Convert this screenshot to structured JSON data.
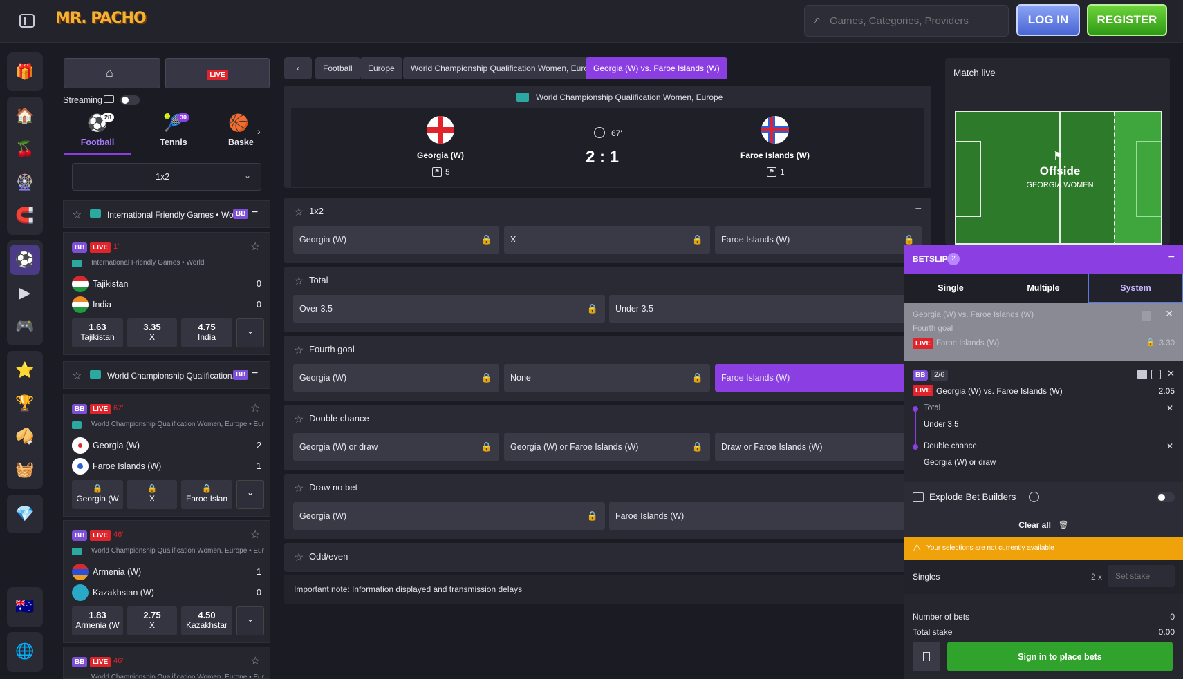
{
  "brand": {
    "logo_text": "MR. PACHO"
  },
  "search": {
    "placeholder": "Games, Categories, Providers"
  },
  "auth": {
    "login": "LOG IN",
    "register": "REGISTER"
  },
  "left_panel": {
    "live_button": "LIVE",
    "streaming_label": "Streaming",
    "sports": [
      {
        "name": "Football",
        "count": "28"
      },
      {
        "name": "Tennis",
        "count": "30"
      },
      {
        "name": "Baske",
        "count": ""
      }
    ],
    "market_select": "1x2",
    "leagues": [
      {
        "title": "International Friendly Games • Wo...",
        "badge": "BB"
      },
      {
        "title": "World Championship Qualification...",
        "badge": "BB"
      }
    ],
    "matches": [
      {
        "bb": "BB",
        "live": "LIVE",
        "minute": "1'",
        "league": "International Friendly Games • World",
        "team1": "Tajikistan",
        "score1": "0",
        "team2": "India",
        "score2": "0",
        "odds": [
          {
            "v": "1.63",
            "l": "Tajikistan"
          },
          {
            "v": "3.35",
            "l": "X"
          },
          {
            "v": "4.75",
            "l": "India"
          }
        ]
      },
      {
        "bb": "BB",
        "live": "LIVE",
        "minute": "67'",
        "league": "World Championship Qualification Women, Europe • Euro...",
        "team1": "Georgia (W)",
        "score1": "2",
        "team2": "Faroe Islands (W)",
        "score2": "1",
        "odds": [
          {
            "v": "",
            "l": "Georgia (W"
          },
          {
            "v": "",
            "l": "X"
          },
          {
            "v": "",
            "l": "Faroe Islan"
          }
        ]
      },
      {
        "bb": "BB",
        "live": "LIVE",
        "minute": "46'",
        "league": "World Championship Qualification Women, Europe • Euro...",
        "team1": "Armenia (W)",
        "score1": "1",
        "team2": "Kazakhstan (W)",
        "score2": "0",
        "odds": [
          {
            "v": "1.83",
            "l": "Armenia (W"
          },
          {
            "v": "2.75",
            "l": "X"
          },
          {
            "v": "4.50",
            "l": "Kazakhstar"
          }
        ]
      },
      {
        "bb": "BB",
        "live": "LIVE",
        "minute": "46'",
        "league": "World Championship Qualification Women, Europe • Euro..."
      }
    ]
  },
  "breadcrumbs": [
    "Football",
    "Europe",
    "World Championship Qualification Women, Europe",
    "Georgia (W) vs. Faroe Islands (W)"
  ],
  "scoreboard": {
    "competition": "World Championship Qualification Women, Europe",
    "home": "Georgia (W)",
    "home_corners": "5",
    "away": "Faroe Islands (W)",
    "away_corners": "1",
    "minute": "67'",
    "score": "2 : 1"
  },
  "markets": [
    {
      "title": "1x2",
      "selections": [
        "Georgia (W)",
        "X",
        "Faroe Islands (W)"
      ]
    },
    {
      "title": "Total",
      "selections": [
        "Over 3.5",
        "Under 3.5"
      ]
    },
    {
      "title": "Fourth goal",
      "selections": [
        "Georgia (W)",
        "None",
        "Faroe Islands (W)"
      ]
    },
    {
      "title": "Double chance",
      "selections": [
        "Georgia (W) or draw",
        "Georgia (W) or Faroe Islands (W)",
        "Draw or Faroe Islands (W)"
      ]
    },
    {
      "title": "Draw no bet",
      "selections": [
        "Georgia (W)",
        "Faroe Islands (W)"
      ]
    },
    {
      "title": "Odd/even",
      "selections": []
    }
  ],
  "note": "Important note: Information displayed and transmission delays",
  "match_live": {
    "title": "Match live",
    "event": "Offside",
    "team": "GEORGIA WOMEN"
  },
  "betslip": {
    "title": "BETSLIP",
    "count": "2",
    "tabs": [
      "Single",
      "Multiple",
      "System"
    ],
    "bet1": {
      "match": "Georgia (W) vs. Faroe Islands (W)",
      "market": "Fourth goal",
      "live": "LIVE",
      "selection": "Faroe Islands (W)",
      "odds": "3.30"
    },
    "bet2": {
      "bb": "BB",
      "ratio": "2/6",
      "live": "LIVE",
      "match": "Georgia (W) vs. Faroe Islands (W)",
      "odds": "2.05",
      "legs": [
        {
          "market": "Total",
          "selection": "Under 3.5"
        },
        {
          "market": "Double chance",
          "selection": "Georgia (W) or draw"
        }
      ]
    },
    "explode": "Explode Bet Builders",
    "clear_all": "Clear all",
    "warning": "Your selections are not currently available",
    "singles": "Singles",
    "singles_mult": "2 x",
    "stake_placeholder": "Set stake",
    "num_bets_label": "Number of bets",
    "num_bets": "0",
    "total_stake_label": "Total stake",
    "total_stake": "0.00",
    "sign_in": "Sign in to place bets"
  },
  "colors": {
    "accent": "#8b3fe2",
    "live": "#e0242b",
    "register": "#3fb81c",
    "login": "#5a7ae0",
    "warning": "#f0a20a",
    "sign_in": "#2fa32b"
  }
}
